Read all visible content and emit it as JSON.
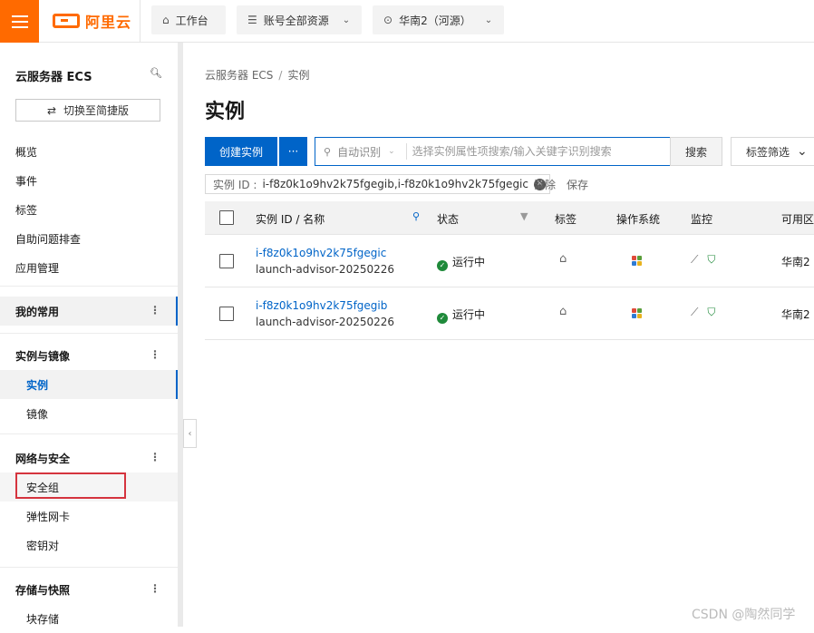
{
  "topbar": {
    "logo_text": "阿里云",
    "workbench": "工作台",
    "resources": "账号全部资源",
    "region": "华南2（河源）"
  },
  "sidebar": {
    "title": "云服务器 ECS",
    "switch_label": "切换至简捷版",
    "top_items": [
      "概览",
      "事件",
      "标签",
      "自助问题排查",
      "应用管理"
    ],
    "groups": {
      "favorites": "我的常用",
      "instances_images": "实例与镜像",
      "network_security": "网络与安全",
      "storage": "存储与快照"
    },
    "sub_items": {
      "instance": "实例",
      "image": "镜像",
      "security_group": "安全组",
      "eni": "弹性网卡",
      "keypair": "密钥对",
      "block_storage": "块存储"
    }
  },
  "main": {
    "breadcrumb": [
      "云服务器 ECS",
      "实例"
    ],
    "breadcrumb_sep": "/",
    "title": "实例",
    "create_button": "创建实例",
    "more_button": "···",
    "search": {
      "mode": "自动识别",
      "placeholder": "选择实例属性项搜索/输入关键字识别搜索",
      "button": "搜索"
    },
    "tag_filter": "标签筛选",
    "filter_chip": {
      "key": "实例 ID :",
      "value": "i-f8z0k1o9hv2k75fgegib,i-f8z0k1o9hv2k75fgegic"
    },
    "clear": "清除",
    "save": "保存",
    "table": {
      "columns": [
        "实例 ID / 名称",
        "状态",
        "标签",
        "操作系统",
        "监控",
        "可用区"
      ],
      "rows": [
        {
          "id": "i-f8z0k1o9hv2k75fgegic",
          "name": "launch-advisor-20250226",
          "status": "运行中",
          "zone": "华南2"
        },
        {
          "id": "i-f8z0k1o9hv2k75fgegib",
          "name": "launch-advisor-20250226",
          "status": "运行中",
          "zone": "华南2"
        }
      ]
    }
  },
  "watermark": "CSDN @陶然同学",
  "colors": {
    "brand": "#ff6a00",
    "primary": "#0064c8",
    "running": "#1f8a3a",
    "highlight": "#d5343e"
  }
}
